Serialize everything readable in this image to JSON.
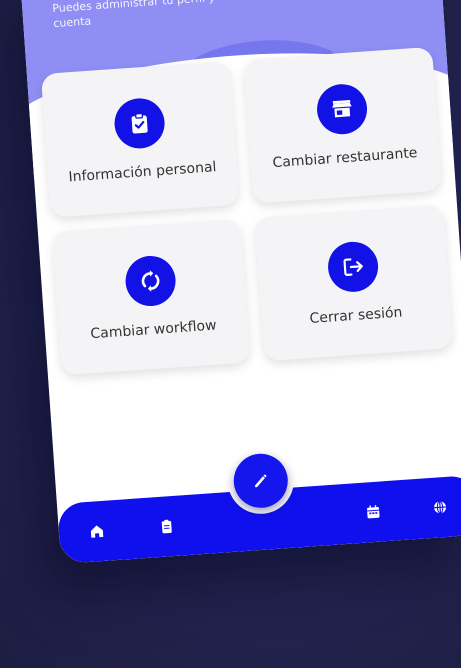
{
  "header": {
    "subtitle": "Puedes administrar tu perfil y cuenta"
  },
  "menu": {
    "items": [
      {
        "label": "Información personal",
        "icon": "clipboard-check-icon"
      },
      {
        "label": "Cambiar restaurante",
        "icon": "store-icon"
      },
      {
        "label": "Cambiar workflow",
        "icon": "sync-icon"
      },
      {
        "label": "Cerrar sesión",
        "icon": "logout-icon"
      }
    ]
  },
  "bottom_nav": {
    "items": [
      "home-icon",
      "clipboard-icon",
      "edit-icon",
      "calendar-icon",
      "globe-icon"
    ]
  },
  "colors": {
    "accent": "#1212e6",
    "header": "#8e8ef4"
  }
}
